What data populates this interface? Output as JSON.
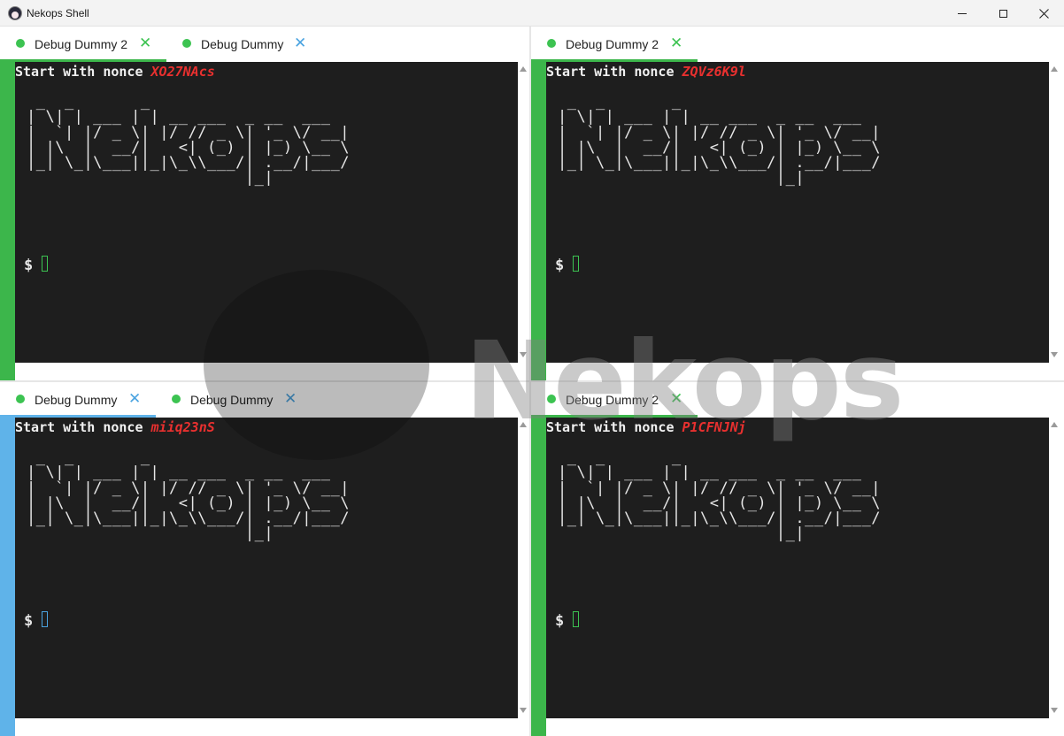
{
  "window": {
    "title": "Nekops Shell"
  },
  "colors": {
    "status_green": "#3cc351",
    "close_green": "#3cc351",
    "close_blue": "#4aa3e0",
    "focus_green": "#3cb64b",
    "focus_blue": "#5fb3e9",
    "terminal_bg": "#1e1e1e",
    "nonce_red": "#e8302f"
  },
  "watermark": {
    "text": "Nekops"
  },
  "panes": [
    {
      "tabs": [
        {
          "label": "Debug Dummy 2",
          "active": true
        },
        {
          "label": "Debug Dummy",
          "active": false
        }
      ],
      "terminal": {
        "nonce_prefix": "Start with nonce ",
        "nonce": "XO27NAcs",
        "ascii_art": " _  _       _\n| \\| | ___ | | __ ___  _ __  ___\n|  `| |/ _ \\| |/ // _ \\| '_ \\/ __|\n| |\\  |  __/|   <| (_) | |_) \\__ \\\n|_| \\_|\\___||_|\\_\\\\___/| .__/|___/\n                       |_|",
        "prompt": "$"
      }
    },
    {
      "tabs": [
        {
          "label": "Debug Dummy 2",
          "active": true
        }
      ],
      "terminal": {
        "nonce_prefix": "Start with nonce ",
        "nonce": "ZQVz6K9l",
        "ascii_art": " _  _       _\n| \\| | ___ | | __ ___  _ __  ___\n|  `| |/ _ \\| |/ // _ \\| '_ \\/ __|\n| |\\  |  __/|   <| (_) | |_) \\__ \\\n|_| \\_|\\___||_|\\_\\\\___/| .__/|___/\n                       |_|",
        "prompt": "$"
      }
    },
    {
      "tabs": [
        {
          "label": "Debug Dummy",
          "active": true
        },
        {
          "label": "Debug Dummy",
          "active": false
        }
      ],
      "terminal": {
        "nonce_prefix": "Start with nonce ",
        "nonce": "miiq23nS",
        "ascii_art": " _  _       _\n| \\| | ___ | | __ ___  _ __  ___\n|  `| |/ _ \\| |/ // _ \\| '_ \\/ __|\n| |\\  |  __/|   <| (_) | |_) \\__ \\\n|_| \\_|\\___||_|\\_\\\\___/| .__/|___/\n                       |_|",
        "prompt": "$"
      }
    },
    {
      "tabs": [
        {
          "label": "Debug Dummy 2",
          "active": true
        }
      ],
      "terminal": {
        "nonce_prefix": "Start with nonce ",
        "nonce": "P1CFNJNj",
        "ascii_art": " _  _       _\n| \\| | ___ | | __ ___  _ __  ___\n|  `| |/ _ \\| |/ // _ \\| '_ \\/ __|\n| |\\  |  __/|   <| (_) | |_) \\__ \\\n|_| \\_|\\___||_|\\_\\\\___/| .__/|___/\n                       |_|",
        "prompt": "$"
      }
    }
  ]
}
